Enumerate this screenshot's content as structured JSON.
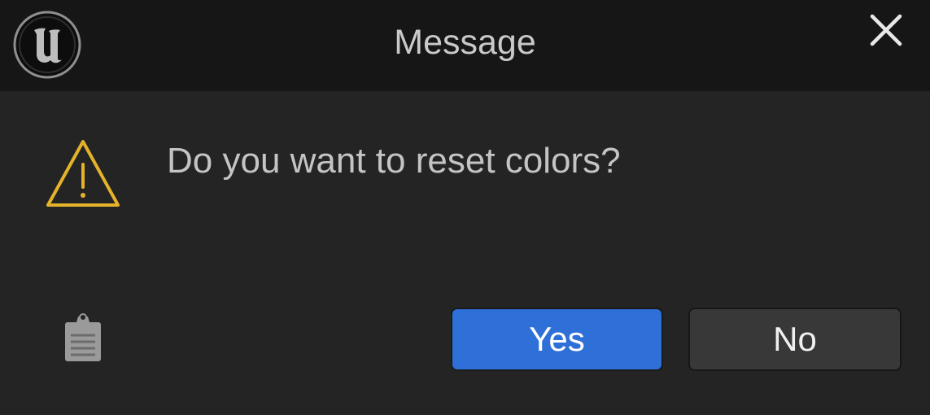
{
  "window": {
    "title": "Message",
    "logo_icon": "unreal-engine-logo-icon",
    "close_icon": "close-icon"
  },
  "dialog": {
    "icon": "warning-icon",
    "message": "Do you want to reset colors?",
    "copy_icon": "clipboard-icon",
    "yes_label": "Yes",
    "no_label": "No"
  },
  "colors": {
    "titlebar_bg": "#161616",
    "body_bg": "#242424",
    "warning": "#e4b32a",
    "primary_button": "#2f6fd8",
    "secondary_button": "#383838"
  }
}
